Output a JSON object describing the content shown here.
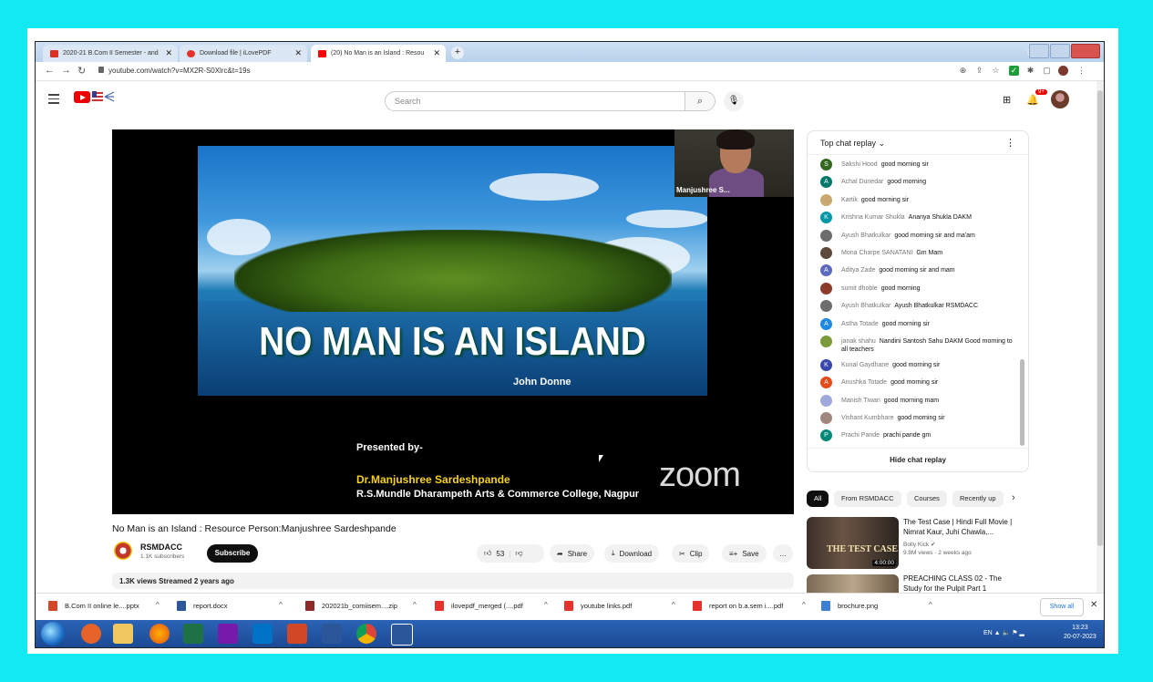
{
  "browser": {
    "tabs": [
      {
        "label": "2020-21 B.Com II Semester - and",
        "color": "#d93025"
      },
      {
        "label": "Download file | iLovePDF",
        "color": "#e5322d"
      },
      {
        "label": "(20) No Man is an Island : Resou",
        "color": "#ff0000"
      }
    ],
    "new_tab": "+",
    "url": "youtube.com/watch?v=MX2R-S0Xlrc&t=19s"
  },
  "youtube": {
    "search_placeholder": "Search",
    "notifications_badge": "9+",
    "video": {
      "slide_title": "NO MAN IS AN ISLAND",
      "slide_author": "John Donne",
      "presented_by": "Presented by-",
      "presenter": "Dr.Manjushree Sardeshpande",
      "college": "R.S.Mundle Dharampeth Arts & Commerce College, Nagpur",
      "watermark": "zoom",
      "cam_name": "Manjushree S..."
    },
    "title": "No Man is an Island : Resource Person:Manjushree Sardeshpande",
    "channel": {
      "name": "RSMDACC",
      "subscribers": "1.1K subscribers",
      "subscribe": "Subscribe"
    },
    "actions": {
      "likes": "53",
      "share": "Share",
      "download": "Download",
      "clip": "Clip",
      "save": "Save",
      "more": "…"
    },
    "stats": "1.3K views  Streamed 2 years ago",
    "chat": {
      "header": "Top chat replay",
      "hide": "Hide chat replay",
      "messages": [
        {
          "author": "Sakshi Hood",
          "text": "good morning sir",
          "initial": "S",
          "color": "#33691e"
        },
        {
          "author": "Achal Dunedar",
          "text": "good morning",
          "initial": "A",
          "color": "#00796b"
        },
        {
          "author": "Kartik",
          "text": "good morning sir",
          "initial": "",
          "color": "#c9a96e"
        },
        {
          "author": "Krishna Kumar Shukla",
          "text": "Ananya Shukla DAKM",
          "initial": "K",
          "color": "#0097a7"
        },
        {
          "author": "Ayush Bhatkulkar",
          "text": "good morning sir and ma'am",
          "initial": "",
          "color": "#6d6d6d"
        },
        {
          "author": "Mona Charpe SANATANI",
          "text": "Gm Mam",
          "initial": "",
          "color": "#5d4a3c"
        },
        {
          "author": "Aditya Zade",
          "text": "good morning sir and mam",
          "initial": "A",
          "color": "#5c6bc0"
        },
        {
          "author": "sumit dhoble",
          "text": "good morning",
          "initial": "",
          "color": "#8d3b2b"
        },
        {
          "author": "Ayush Bhatkulkar",
          "text": "Ayush Bhatkulkar RSMDACC",
          "initial": "",
          "color": "#6d6d6d"
        },
        {
          "author": "Astha Totade",
          "text": "good morning sir",
          "initial": "A",
          "color": "#1e88e5"
        },
        {
          "author": "janak shahu",
          "text": "Nandini Santosh Sahu DAKM Good morning to all teachers",
          "initial": "",
          "color": "#7c9a3c"
        },
        {
          "author": "Kunal Gaydhane",
          "text": "good morning sir",
          "initial": "K",
          "color": "#3949ab"
        },
        {
          "author": "Anushka Totade",
          "text": "good morning sir",
          "initial": "A",
          "color": "#e64a19"
        },
        {
          "author": "Manish Tiwari",
          "text": "good morning mam",
          "initial": "",
          "color": "#9fa8da"
        },
        {
          "author": "Vishant Kumbhare",
          "text": "good morning sir",
          "initial": "",
          "color": "#a1887f"
        },
        {
          "author": "Prachi Pande",
          "text": "prachi pande gm",
          "initial": "P",
          "color": "#00897b"
        }
      ]
    },
    "chips": [
      "All",
      "From RSMDACC",
      "Courses",
      "Recently up"
    ],
    "recommendations": [
      {
        "title": "The Test Case | Hindi Full Movie | Nimrat Kaur, Juhi Chawla,...",
        "channel": "Bolly Kick",
        "meta": "9.8M views · 2 weeks ago",
        "duration": "4:00:00",
        "thumb_text": "THE TEST CASE"
      },
      {
        "title": "PREACHING CLASS 02 - The Study for the Pulpit Part 1",
        "channel": "",
        "meta": "",
        "duration": "",
        "thumb_text": ""
      }
    ]
  },
  "downloads": {
    "items": [
      {
        "name": "B.Com II online le....pptx",
        "color": "#d24726"
      },
      {
        "name": "report.docx",
        "color": "#2b579a"
      },
      {
        "name": "202021b_comiisem....zip",
        "color": "#8e2a2a"
      },
      {
        "name": "ilovepdf_merged (....pdf",
        "color": "#e5322d"
      },
      {
        "name": "youtube links.pdf",
        "color": "#e5322d"
      },
      {
        "name": "report on b.a.sem i....pdf",
        "color": "#e5322d"
      },
      {
        "name": "brochure.png",
        "color": "#3d7fd1"
      }
    ],
    "show_all": "Show all"
  },
  "taskbar": {
    "lang": "EN",
    "time": "13:23",
    "date": "20-07-2023"
  }
}
